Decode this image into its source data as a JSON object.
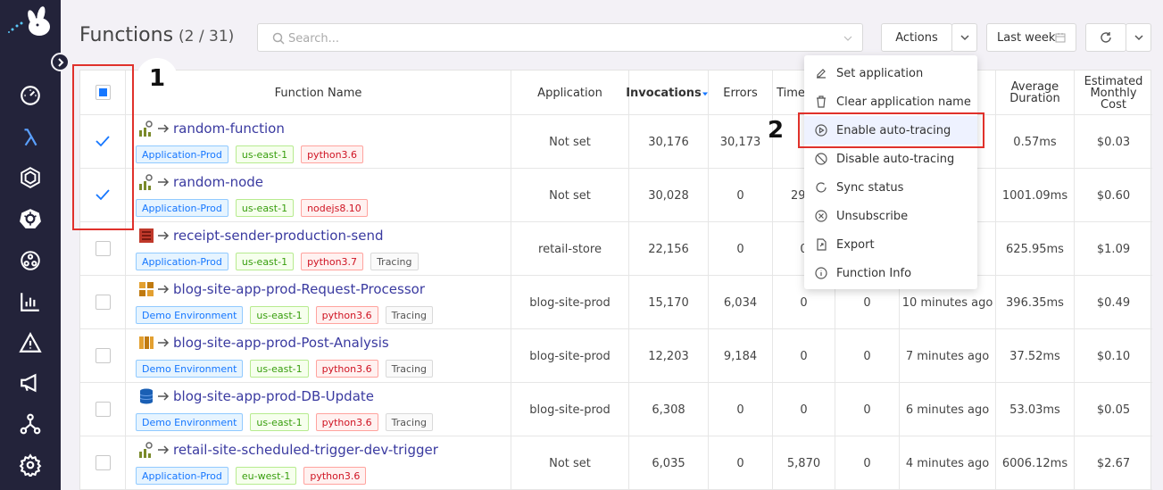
{
  "header": {
    "title": "Functions",
    "count": "(2 / 31)",
    "search_placeholder": "Search...",
    "actions_label": "Actions",
    "time_range_label": "Last week"
  },
  "sidebar": {
    "items": [
      "dashboard-icon",
      "lambda-icon",
      "hexagon-icon",
      "kubernetes-icon",
      "distributed-icon",
      "bar-chart-icon",
      "warning-icon",
      "megaphone-icon",
      "network-icon",
      "settings-icon"
    ]
  },
  "table": {
    "columns": {
      "function_name": "Function Name",
      "application": "Application",
      "invocations": "Invocations",
      "errors": "Errors",
      "timeouts": "Time",
      "avg_duration": "Average Duration",
      "cost": "Estimated Monthly Cost"
    },
    "rows": [
      {
        "name": "random-function",
        "icon": "metrics-icon",
        "tags": [
          {
            "t": "Application-Prod",
            "k": "env"
          },
          {
            "t": "us-east-1",
            "k": "region"
          },
          {
            "t": "python3.6",
            "k": "runtime"
          }
        ],
        "application": "Not set",
        "invocations": "30,176",
        "errors": "30,173",
        "timeouts": "",
        "col8": "",
        "last": "",
        "avg": "0.57ms",
        "cost": "$0.03",
        "checked": true
      },
      {
        "name": "random-node",
        "icon": "metrics-icon",
        "tags": [
          {
            "t": "Application-Prod",
            "k": "env"
          },
          {
            "t": "us-east-1",
            "k": "region"
          },
          {
            "t": "nodejs8.10",
            "k": "runtime"
          }
        ],
        "application": "Not set",
        "invocations": "30,028",
        "errors": "0",
        "timeouts": "29,8",
        "col8": "",
        "last": "ago",
        "avg": "1001.09ms",
        "cost": "$0.60",
        "checked": true
      },
      {
        "name": "receipt-sender-production-send",
        "icon": "aws-red-icon",
        "tags": [
          {
            "t": "Application-Prod",
            "k": "env"
          },
          {
            "t": "us-east-1",
            "k": "region"
          },
          {
            "t": "python3.7",
            "k": "runtime"
          },
          {
            "t": "Tracing",
            "k": "tracing"
          }
        ],
        "application": "retail-store",
        "invocations": "22,156",
        "errors": "0",
        "timeouts": "0",
        "col8": "",
        "last": "",
        "avg": "625.95ms",
        "cost": "$1.09",
        "checked": false
      },
      {
        "name": "blog-site-app-prod-Request-Processor",
        "icon": "aws-orange-icon",
        "tags": [
          {
            "t": "Demo Environment",
            "k": "env"
          },
          {
            "t": "us-east-1",
            "k": "region"
          },
          {
            "t": "python3.6",
            "k": "runtime"
          },
          {
            "t": "Tracing",
            "k": "tracing"
          }
        ],
        "application": "blog-site-prod",
        "invocations": "15,170",
        "errors": "6,034",
        "timeouts": "0",
        "col8": "0",
        "last": "10 minutes ago",
        "avg": "396.35ms",
        "cost": "$0.49",
        "checked": false
      },
      {
        "name": "blog-site-app-prod-Post-Analysis",
        "icon": "aws-orange2-icon",
        "tags": [
          {
            "t": "Demo Environment",
            "k": "env"
          },
          {
            "t": "us-east-1",
            "k": "region"
          },
          {
            "t": "python3.6",
            "k": "runtime"
          },
          {
            "t": "Tracing",
            "k": "tracing"
          }
        ],
        "application": "blog-site-prod",
        "invocations": "12,203",
        "errors": "9,184",
        "timeouts": "0",
        "col8": "0",
        "last": "7 minutes ago",
        "avg": "37.52ms",
        "cost": "$0.10",
        "checked": false
      },
      {
        "name": "blog-site-app-prod-DB-Update",
        "icon": "database-icon",
        "tags": [
          {
            "t": "Demo Environment",
            "k": "env"
          },
          {
            "t": "us-east-1",
            "k": "region"
          },
          {
            "t": "python3.6",
            "k": "runtime"
          },
          {
            "t": "Tracing",
            "k": "tracing"
          }
        ],
        "application": "blog-site-prod",
        "invocations": "6,308",
        "errors": "0",
        "timeouts": "0",
        "col8": "0",
        "last": "6 minutes ago",
        "avg": "53.03ms",
        "cost": "$0.05",
        "checked": false
      },
      {
        "name": "retail-site-scheduled-trigger-dev-trigger",
        "icon": "metrics-icon",
        "tags": [
          {
            "t": "Application-Prod",
            "k": "env"
          },
          {
            "t": "eu-west-1",
            "k": "region"
          },
          {
            "t": "python3.6",
            "k": "runtime"
          }
        ],
        "application": "Not set",
        "invocations": "6,035",
        "errors": "0",
        "timeouts": "5,870",
        "col8": "0",
        "last": "4 minutes ago",
        "avg": "6006.12ms",
        "cost": "$2.67",
        "checked": false
      }
    ]
  },
  "dropdown": {
    "items": [
      {
        "label": "Set application",
        "icon": "edit-icon"
      },
      {
        "label": "Clear application name",
        "icon": "trash-icon"
      },
      {
        "label": "Enable auto-tracing",
        "icon": "play-circle-icon"
      },
      {
        "label": "Disable auto-tracing",
        "icon": "stop-icon"
      },
      {
        "label": "Sync status",
        "icon": "sync-icon"
      },
      {
        "label": "Unsubscribe",
        "icon": "close-circle-icon"
      },
      {
        "label": "Export",
        "icon": "export-icon"
      },
      {
        "label": "Function Info",
        "icon": "info-icon"
      }
    ]
  },
  "annotations": {
    "label_1": "1",
    "label_2": "2"
  },
  "colors": {
    "sidebar_bg": "#23233a",
    "accent": "#1677ff",
    "annotation": "#e0312b",
    "function_name": "#3a3aa0"
  }
}
